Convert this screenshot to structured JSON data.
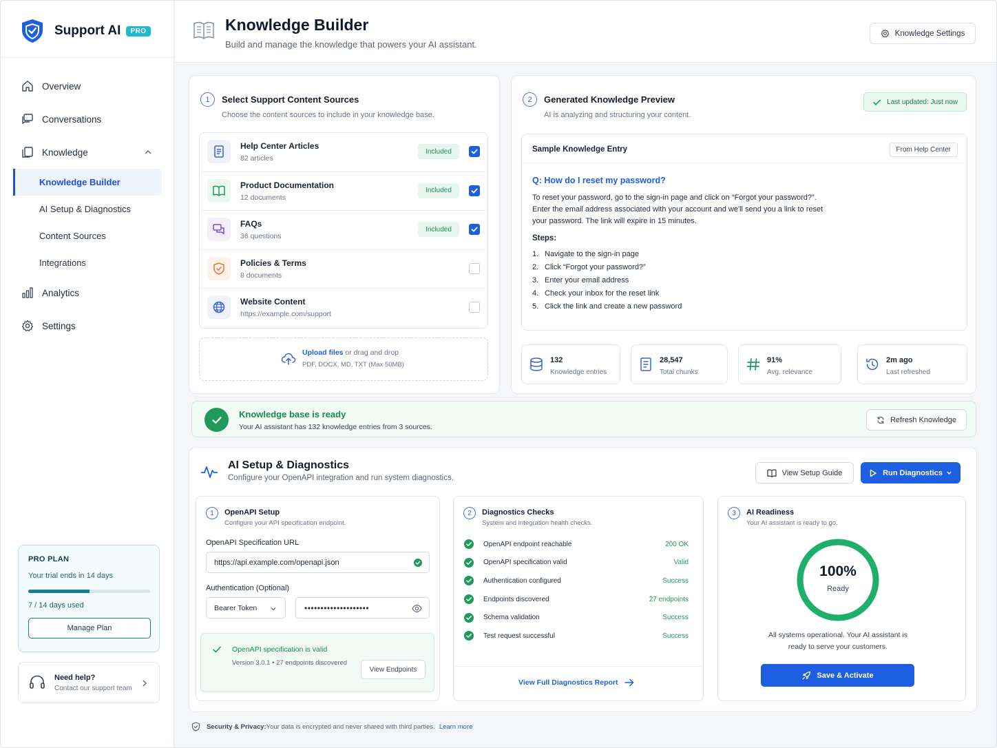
{
  "brand": {
    "name": "Support AI",
    "badge": "PRO"
  },
  "nav": {
    "overview": "Overview",
    "conversations": "Conversations",
    "knowledge": "Knowledge",
    "sub": [
      "Knowledge Builder",
      "AI Setup & Diagnostics",
      "Content Sources",
      "Integrations"
    ],
    "analytics": "Analytics",
    "settings": "Settings"
  },
  "plan": {
    "title": "PRO PLAN",
    "trial": "Your trial ends in 14 days",
    "used": "7 / 14 days used",
    "progress": 0.5,
    "button": "Manage Plan"
  },
  "help": {
    "title": "Need help?",
    "sub": "Contact our support team"
  },
  "header": {
    "title": "Knowledge Builder",
    "subtitle": "Build and manage the knowledge that powers your AI assistant.",
    "settings_btn": "Knowledge Settings"
  },
  "sources": {
    "step": "1",
    "title": "Select Support Content Sources",
    "subtitle": "Choose the content sources to include in your knowledge base.",
    "items": [
      {
        "name": "Help Center Articles",
        "meta": "82 articles",
        "badge": "Included",
        "icon": "document-icon"
      },
      {
        "name": "Product Documentation",
        "meta": "12 documents",
        "badge": "Included",
        "icon": "book-icon"
      },
      {
        "name": "FAQs",
        "meta": "36 questions",
        "badge": "Included",
        "icon": "chat-bubbles-icon"
      },
      {
        "name": "Policies & Terms",
        "meta": "8 documents",
        "badge": "",
        "icon": "shield-icon"
      },
      {
        "name": "Website Content",
        "meta": "https://example.com/support",
        "badge": "",
        "icon": "globe-icon"
      }
    ],
    "upload_link": "Upload files",
    "upload_rest": " or drag and drop",
    "upload_types": "PDF, DOCX, MD, TXT (Max 50MB)"
  },
  "preview": {
    "step": "2",
    "title": "Generated Knowledge Preview",
    "subtitle": "AI is analyzing and structuring your content.",
    "updated": "Last updated: Just now",
    "entry_title": "Sample Knowledge Entry",
    "entry_source": "From Help Center",
    "question": "Q: How do I reset my password?",
    "answer": "To reset your password, go to the sign-in page and click on “Forgot your password?”. Enter the email address associated with your account and we'll send you a link to reset your password. The link will expire in 15 minutes.",
    "steps_label": "Steps:",
    "steps": [
      "Navigate to the sign-in page",
      "Click “Forgot your password?”",
      "Enter your email address",
      "Check your inbox for the reset link",
      "Click the link and create a new password"
    ],
    "step_nums": [
      "1.",
      "2.",
      "3.",
      "4.",
      "5."
    ],
    "stats": [
      {
        "value": "132",
        "label": "Knowledge entries"
      },
      {
        "value": "28,547",
        "label": "Total chunks"
      },
      {
        "value": "91%",
        "label": "Avg. relevance"
      },
      {
        "value": "2m ago",
        "label": "Last refreshed"
      }
    ]
  },
  "ready": {
    "title": "Knowledge base is ready",
    "subtitle": "Your AI assistant has 132 knowledge entries from 3 sources.",
    "refresh_btn": "Refresh Knowledge"
  },
  "diagnostics": {
    "title": "AI Setup & Diagnostics",
    "subtitle": "Configure your OpenAPI integration and run system diagnostics.",
    "guide_btn": "View Setup Guide",
    "run_btn": "Run Diagnostics",
    "openapi": {
      "step": "1",
      "title": "OpenAPI Setup",
      "subtitle": "Configure your API specification endpoint.",
      "url_label": "OpenAPI Specification URL",
      "url_value": "https://api.example.com/openapi.json",
      "auth_label": "Authentication (Optional)",
      "auth_type": "Bearer Token",
      "token_mask": "••••••••••••••••••••",
      "valid_title": "OpenAPI specification is valid",
      "valid_sub": "Version 3.0.1 • 27 endpoints discovered",
      "endpoints_btn": "View Endpoints"
    },
    "checks": {
      "step": "2",
      "title": "Diagnostics Checks",
      "subtitle": "System and integration health checks.",
      "items": [
        {
          "label": "OpenAPI endpoint reachable",
          "value": "200 OK"
        },
        {
          "label": "OpenAPI specification valid",
          "value": "Valid"
        },
        {
          "label": "Authentication configured",
          "value": "Success"
        },
        {
          "label": "Endpoints discovered",
          "value": "27 endpoints"
        },
        {
          "label": "Schema validation",
          "value": "Success"
        },
        {
          "label": "Test request successful",
          "value": "Success"
        }
      ],
      "report_link": "View Full Diagnostics Report"
    },
    "readiness": {
      "step": "3",
      "title": "AI Readiness",
      "subtitle": "Your AI assistant is ready to go.",
      "percent": "100%",
      "percent_value": 1.0,
      "status": "Ready",
      "message": "All systems operational. Your AI assistant is ready to serve your customers.",
      "activate_btn": "Save & Activate"
    }
  },
  "footer": {
    "label": "Security & Privacy:",
    "text": " Your data is encrypted and never shared with third parties.",
    "link": "Learn more"
  },
  "colors": {
    "accent": "#1d5fe0",
    "success": "#1f9a5b",
    "brand_teal": "#22b8cf"
  }
}
